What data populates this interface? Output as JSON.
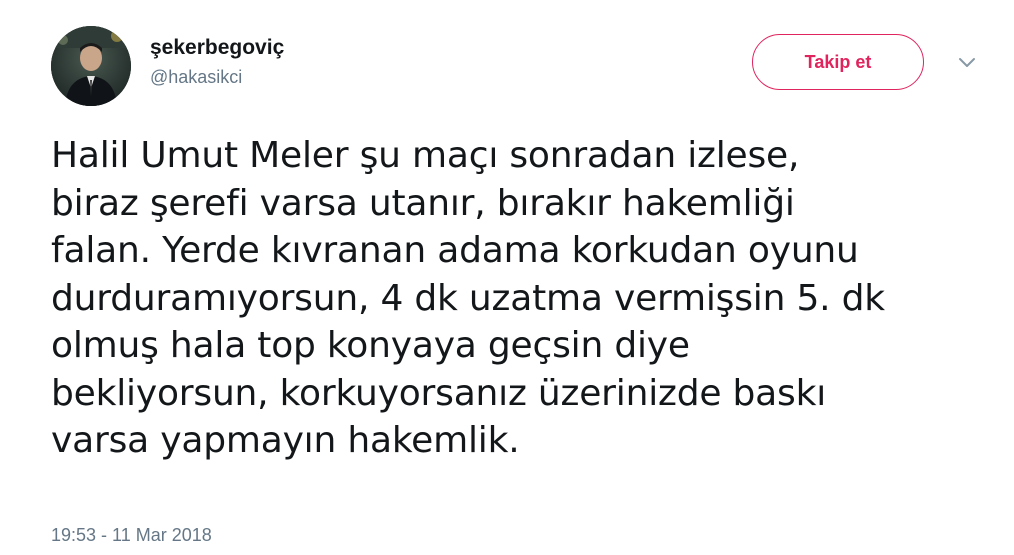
{
  "user": {
    "display_name": "şekerbegoviç",
    "handle": "@hakasikci",
    "avatar_icon": "profile-photo"
  },
  "actions": {
    "follow_label": "Takip et",
    "menu_icon": "chevron-down-icon"
  },
  "tweet": {
    "text": "Halil Umut Meler şu maçı sonradan izlese,\nbiraz şerefi varsa utanır, bırakır hakemliği\nfalan. Yerde kıvranan adama korkudan oyunu\ndurduramıyorsun, 4 dk uzatma vermişsin 5. dk\nolmuş hala top konyaya geçsin diye\nbekliyorsun, korkuyorsanız üzerinizde baskı\nvarsa yapmayın hakemlik.",
    "timestamp": "19:53 - 11 Mar 2018"
  },
  "colors": {
    "accent": "#e0245e",
    "text": "#14171a",
    "secondary": "#657786"
  }
}
